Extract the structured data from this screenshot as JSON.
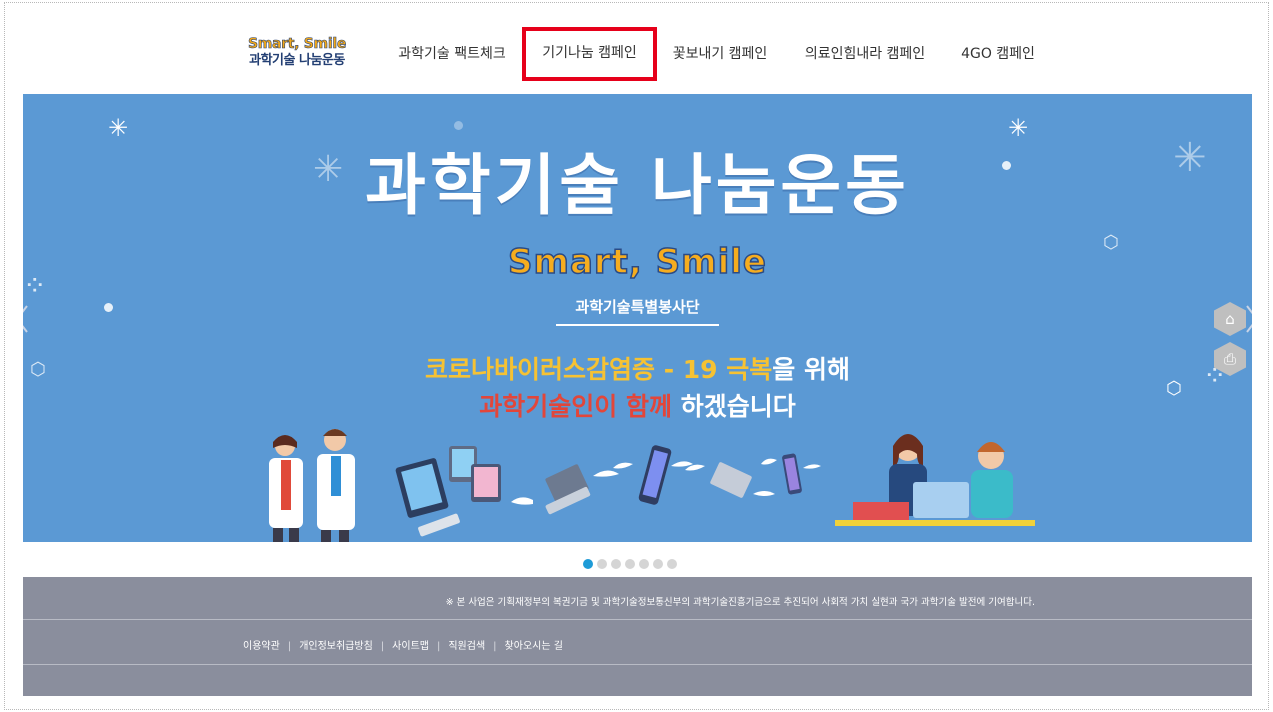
{
  "logo": {
    "line1": "Smart, Smile",
    "line2": "과학기술 나눔운동"
  },
  "nav": [
    {
      "label": "과학기술 팩트체크",
      "active": false
    },
    {
      "label": "기기나눔 캠페인",
      "active": true
    },
    {
      "label": "꽃보내기 캠페인",
      "active": false
    },
    {
      "label": "의료인힘내라 캠페인",
      "active": false
    },
    {
      "label": "4GO 캠페인",
      "active": false
    }
  ],
  "banner": {
    "title": "과학기술 나눔운동",
    "subtitle": "Smart, Smile",
    "org": "과학기술특별봉사단",
    "msg1_part1": "코로나바이러스감염증 - 19 극복",
    "msg1_part2": "을 위해",
    "msg2_part1": "과학기술인이 함께",
    "msg2_part2": " 하겠습니다",
    "colors": {
      "background": "#5b99d4",
      "yellow": "#f6c233",
      "red": "#e2463a",
      "white": "#ffffff"
    }
  },
  "side_buttons": [
    {
      "icon": "home-icon"
    },
    {
      "icon": "print-icon"
    }
  ],
  "pager": {
    "count": 8,
    "active_index": 1
  },
  "footer": {
    "notice": "※ 본 사업은 기획재정부의 복권기금 및 과학기술정보통신부의 과학기술진흥기금으로 추진되어 사회적 가치 실현과 국가 과학기술 발전에 기여합니다.",
    "links": [
      "이용약관",
      "개인정보취급방침",
      "사이트맵",
      "직원검색",
      "찾아오시는 길"
    ]
  }
}
